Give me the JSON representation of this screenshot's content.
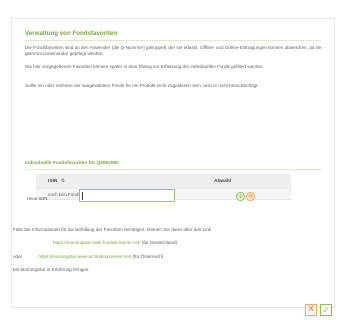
{
  "dialog": {
    "title": "Verwaltung von Fondsfavoriten",
    "paragraphs": [
      "Die Fondsfavoriten sind an den Anwender (die Q-Nummer) gekoppelt, der sie erfasst. Offline- und Online-Eintragungen können abweichen, da sie getrennt voneinander gepflegt werden.",
      "Die hier vorgegebenen Favoriten können später in dem Dialog zur Erfassung der individuellen Fonds gefiltert werden.",
      "Sollte ein oder mehrere der ausgewählten Fonds für ein Produkt nicht zugelassen sein, wird er nicht berücksichtigt."
    ],
    "subheading": "Individuelle Fondsfavoriten für Q5992590",
    "table": {
      "col_isin": "ISIN",
      "sort_icon": "⇅",
      "col_abwahl": "Abwahl",
      "empty_text": "noch kein Fondsfavorit gewählt"
    },
    "new_isin_label": "neue ISIN",
    "new_isin_value": "",
    "info_text": "Falls Sie Informationen für die Befüllung der Favoriten benötigen, können Sie diese über den Link",
    "link_de": "https://morningstar-wwk.fondsscreener.net/",
    "link_de_suffix": "(für Deutschland)",
    "oder": "oder",
    "link_at": "https://morningstar-wwk-at.fondsscreener.net/",
    "link_at_suffix": "(für Österreich)",
    "closing_text": "bei MorningStar in Erfahrung bringen.",
    "buttons": {
      "add_icon": "add-icon",
      "remove_icon": "remove-icon",
      "cancel_icon": "close-icon",
      "ok_icon": "check-icon"
    }
  },
  "colors": {
    "accent_green": "#7aa535",
    "accent_orange": "#ef8a2f"
  }
}
